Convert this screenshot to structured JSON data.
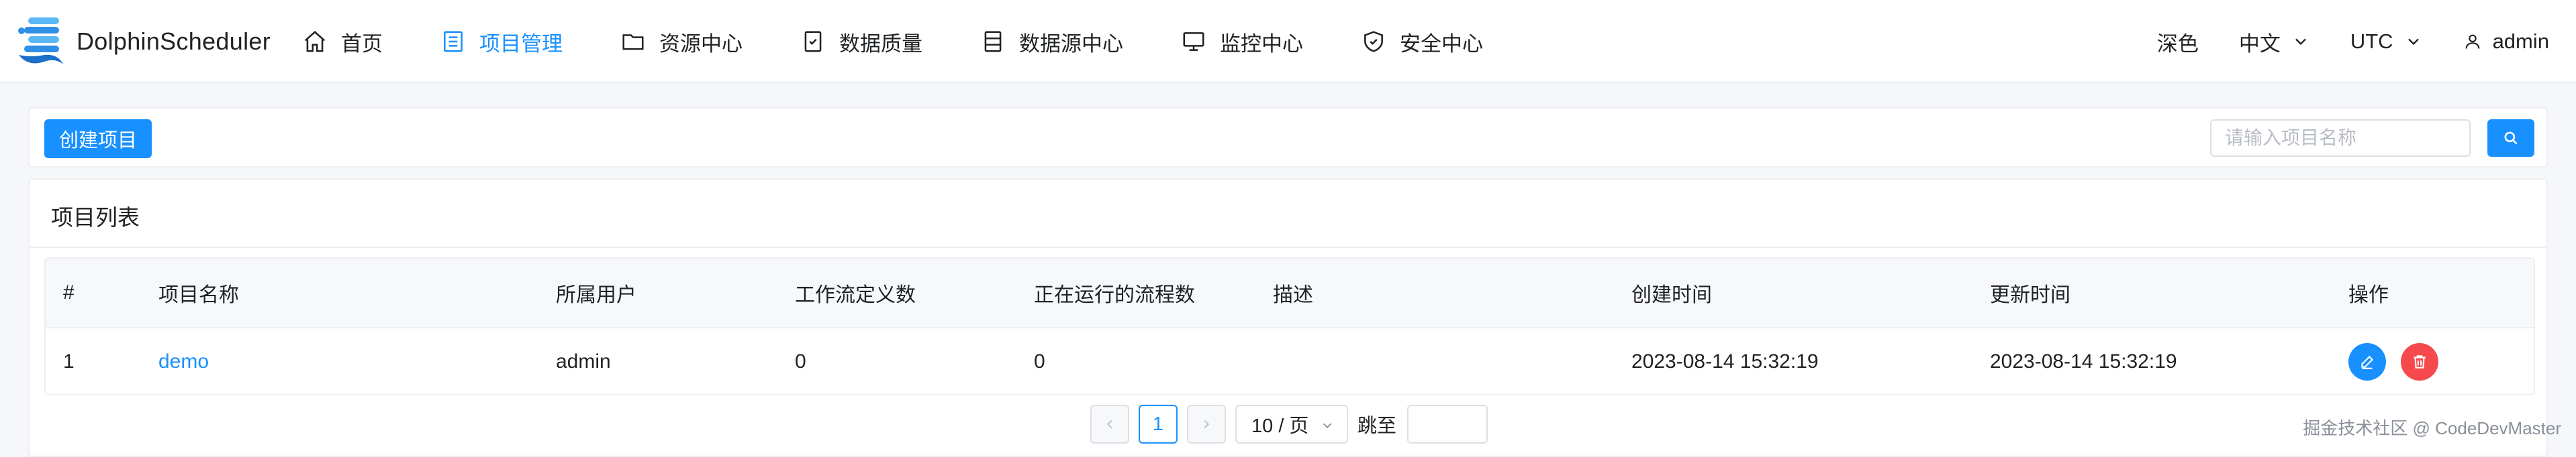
{
  "app": {
    "name": "DolphinScheduler"
  },
  "nav": [
    {
      "label": "首页",
      "icon": "home-icon",
      "active": false
    },
    {
      "label": "项目管理",
      "icon": "project-icon",
      "active": true
    },
    {
      "label": "资源中心",
      "icon": "folder-icon",
      "active": false
    },
    {
      "label": "数据质量",
      "icon": "data-quality-icon",
      "active": false
    },
    {
      "label": "数据源中心",
      "icon": "datasource-icon",
      "active": false
    },
    {
      "label": "监控中心",
      "icon": "monitor-icon",
      "active": false
    },
    {
      "label": "安全中心",
      "icon": "shield-icon",
      "active": false
    }
  ],
  "header_right": {
    "theme": "深色",
    "language": "中文",
    "timezone": "UTC",
    "user": "admin"
  },
  "toolbar": {
    "create_label": "创建项目",
    "search_placeholder": "请输入项目名称",
    "search_value": ""
  },
  "list": {
    "title": "项目列表",
    "columns": [
      "#",
      "项目名称",
      "所属用户",
      "工作流定义数",
      "正在运行的流程数",
      "描述",
      "创建时间",
      "更新时间",
      "操作"
    ],
    "rows": [
      {
        "index": "1",
        "name": "demo",
        "user": "admin",
        "workflow_count": "0",
        "running_count": "0",
        "description": "",
        "created": "2023-08-14 15:32:19",
        "updated": "2023-08-14 15:32:19"
      }
    ]
  },
  "pagination": {
    "current_page": "1",
    "page_size": "10 / 页",
    "jump_label": "跳至",
    "jump_value": ""
  },
  "watermark": "掘金技术社区 @ CodeDevMaster",
  "colors": {
    "primary": "#1890ff",
    "danger": "#f5494d",
    "background": "#f5f7fa"
  }
}
